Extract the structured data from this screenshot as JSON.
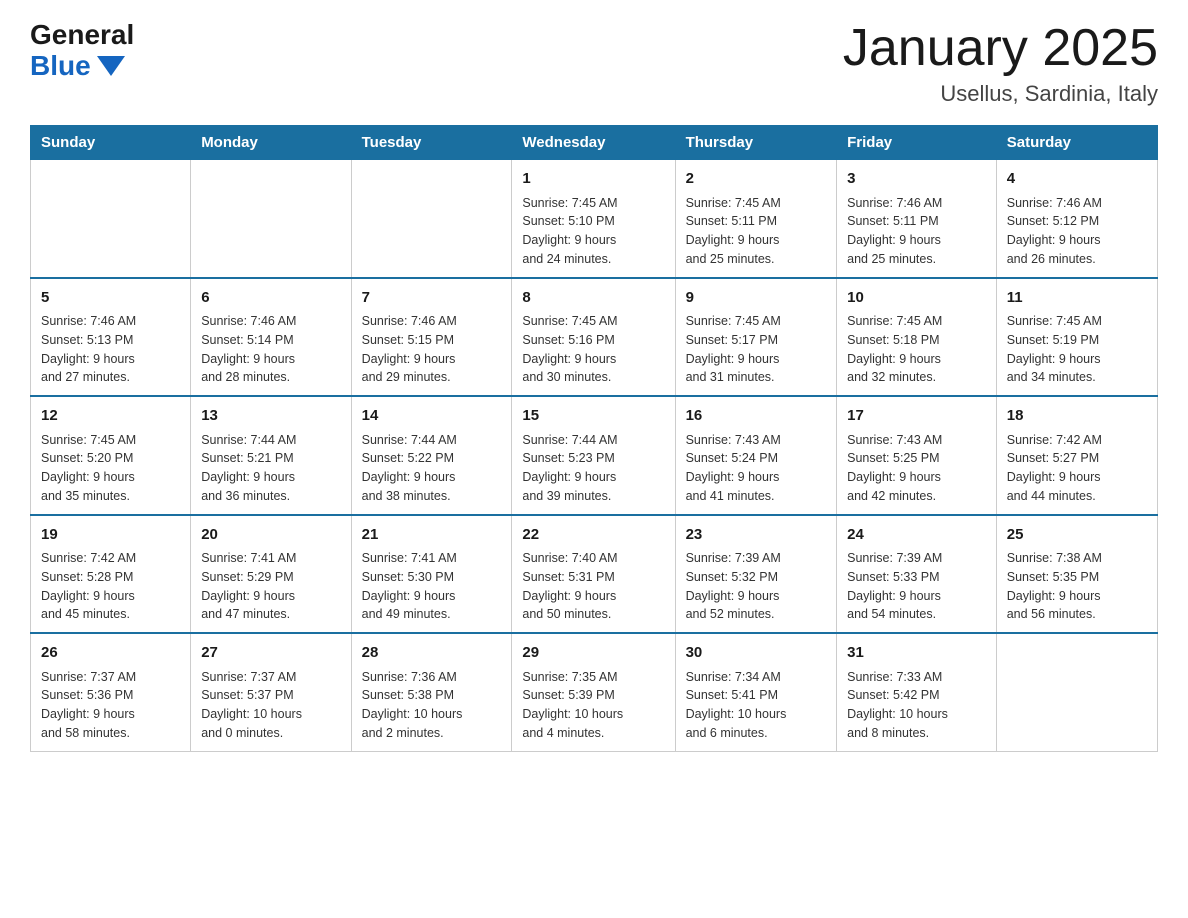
{
  "logo": {
    "general_text": "General",
    "blue_text": "Blue"
  },
  "title": "January 2025",
  "subtitle": "Usellus, Sardinia, Italy",
  "days_of_week": [
    "Sunday",
    "Monday",
    "Tuesday",
    "Wednesday",
    "Thursday",
    "Friday",
    "Saturday"
  ],
  "weeks": [
    [
      {
        "day": "",
        "info": ""
      },
      {
        "day": "",
        "info": ""
      },
      {
        "day": "",
        "info": ""
      },
      {
        "day": "1",
        "info": "Sunrise: 7:45 AM\nSunset: 5:10 PM\nDaylight: 9 hours\nand 24 minutes."
      },
      {
        "day": "2",
        "info": "Sunrise: 7:45 AM\nSunset: 5:11 PM\nDaylight: 9 hours\nand 25 minutes."
      },
      {
        "day": "3",
        "info": "Sunrise: 7:46 AM\nSunset: 5:11 PM\nDaylight: 9 hours\nand 25 minutes."
      },
      {
        "day": "4",
        "info": "Sunrise: 7:46 AM\nSunset: 5:12 PM\nDaylight: 9 hours\nand 26 minutes."
      }
    ],
    [
      {
        "day": "5",
        "info": "Sunrise: 7:46 AM\nSunset: 5:13 PM\nDaylight: 9 hours\nand 27 minutes."
      },
      {
        "day": "6",
        "info": "Sunrise: 7:46 AM\nSunset: 5:14 PM\nDaylight: 9 hours\nand 28 minutes."
      },
      {
        "day": "7",
        "info": "Sunrise: 7:46 AM\nSunset: 5:15 PM\nDaylight: 9 hours\nand 29 minutes."
      },
      {
        "day": "8",
        "info": "Sunrise: 7:45 AM\nSunset: 5:16 PM\nDaylight: 9 hours\nand 30 minutes."
      },
      {
        "day": "9",
        "info": "Sunrise: 7:45 AM\nSunset: 5:17 PM\nDaylight: 9 hours\nand 31 minutes."
      },
      {
        "day": "10",
        "info": "Sunrise: 7:45 AM\nSunset: 5:18 PM\nDaylight: 9 hours\nand 32 minutes."
      },
      {
        "day": "11",
        "info": "Sunrise: 7:45 AM\nSunset: 5:19 PM\nDaylight: 9 hours\nand 34 minutes."
      }
    ],
    [
      {
        "day": "12",
        "info": "Sunrise: 7:45 AM\nSunset: 5:20 PM\nDaylight: 9 hours\nand 35 minutes."
      },
      {
        "day": "13",
        "info": "Sunrise: 7:44 AM\nSunset: 5:21 PM\nDaylight: 9 hours\nand 36 minutes."
      },
      {
        "day": "14",
        "info": "Sunrise: 7:44 AM\nSunset: 5:22 PM\nDaylight: 9 hours\nand 38 minutes."
      },
      {
        "day": "15",
        "info": "Sunrise: 7:44 AM\nSunset: 5:23 PM\nDaylight: 9 hours\nand 39 minutes."
      },
      {
        "day": "16",
        "info": "Sunrise: 7:43 AM\nSunset: 5:24 PM\nDaylight: 9 hours\nand 41 minutes."
      },
      {
        "day": "17",
        "info": "Sunrise: 7:43 AM\nSunset: 5:25 PM\nDaylight: 9 hours\nand 42 minutes."
      },
      {
        "day": "18",
        "info": "Sunrise: 7:42 AM\nSunset: 5:27 PM\nDaylight: 9 hours\nand 44 minutes."
      }
    ],
    [
      {
        "day": "19",
        "info": "Sunrise: 7:42 AM\nSunset: 5:28 PM\nDaylight: 9 hours\nand 45 minutes."
      },
      {
        "day": "20",
        "info": "Sunrise: 7:41 AM\nSunset: 5:29 PM\nDaylight: 9 hours\nand 47 minutes."
      },
      {
        "day": "21",
        "info": "Sunrise: 7:41 AM\nSunset: 5:30 PM\nDaylight: 9 hours\nand 49 minutes."
      },
      {
        "day": "22",
        "info": "Sunrise: 7:40 AM\nSunset: 5:31 PM\nDaylight: 9 hours\nand 50 minutes."
      },
      {
        "day": "23",
        "info": "Sunrise: 7:39 AM\nSunset: 5:32 PM\nDaylight: 9 hours\nand 52 minutes."
      },
      {
        "day": "24",
        "info": "Sunrise: 7:39 AM\nSunset: 5:33 PM\nDaylight: 9 hours\nand 54 minutes."
      },
      {
        "day": "25",
        "info": "Sunrise: 7:38 AM\nSunset: 5:35 PM\nDaylight: 9 hours\nand 56 minutes."
      }
    ],
    [
      {
        "day": "26",
        "info": "Sunrise: 7:37 AM\nSunset: 5:36 PM\nDaylight: 9 hours\nand 58 minutes."
      },
      {
        "day": "27",
        "info": "Sunrise: 7:37 AM\nSunset: 5:37 PM\nDaylight: 10 hours\nand 0 minutes."
      },
      {
        "day": "28",
        "info": "Sunrise: 7:36 AM\nSunset: 5:38 PM\nDaylight: 10 hours\nand 2 minutes."
      },
      {
        "day": "29",
        "info": "Sunrise: 7:35 AM\nSunset: 5:39 PM\nDaylight: 10 hours\nand 4 minutes."
      },
      {
        "day": "30",
        "info": "Sunrise: 7:34 AM\nSunset: 5:41 PM\nDaylight: 10 hours\nand 6 minutes."
      },
      {
        "day": "31",
        "info": "Sunrise: 7:33 AM\nSunset: 5:42 PM\nDaylight: 10 hours\nand 8 minutes."
      },
      {
        "day": "",
        "info": ""
      }
    ]
  ]
}
